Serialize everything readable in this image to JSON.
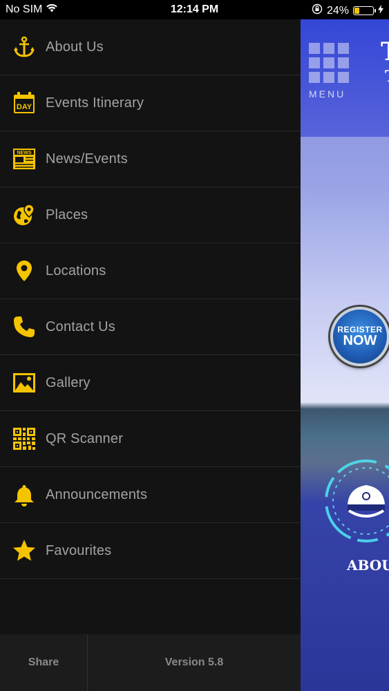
{
  "status_bar": {
    "carrier": "No SIM",
    "time": "12:14 PM",
    "battery_percent": "24%",
    "battery_level": 0.24
  },
  "menu": {
    "items": [
      {
        "label": "About Us",
        "icon": "anchor-icon"
      },
      {
        "label": "Events Itinerary",
        "icon": "calendar-day-icon"
      },
      {
        "label": "News/Events",
        "icon": "newspaper-icon"
      },
      {
        "label": "Places",
        "icon": "globe-pin-icon"
      },
      {
        "label": "Locations",
        "icon": "map-pin-icon"
      },
      {
        "label": "Contact Us",
        "icon": "phone-icon"
      },
      {
        "label": "Gallery",
        "icon": "image-icon"
      },
      {
        "label": "QR Scanner",
        "icon": "qr-code-icon"
      },
      {
        "label": "Announcements",
        "icon": "bell-icon"
      },
      {
        "label": "Favourites",
        "icon": "star-icon"
      }
    ],
    "accent_color": "#f5c400"
  },
  "footer": {
    "share_label": "Share",
    "version_label": "Version 5.8"
  },
  "app_peek": {
    "menu_label": "MENU",
    "title_fragment": "T",
    "title_fragment2": "T",
    "register_line1": "REGISTER",
    "register_line2": "NOW",
    "about_label": "ABOUT"
  }
}
